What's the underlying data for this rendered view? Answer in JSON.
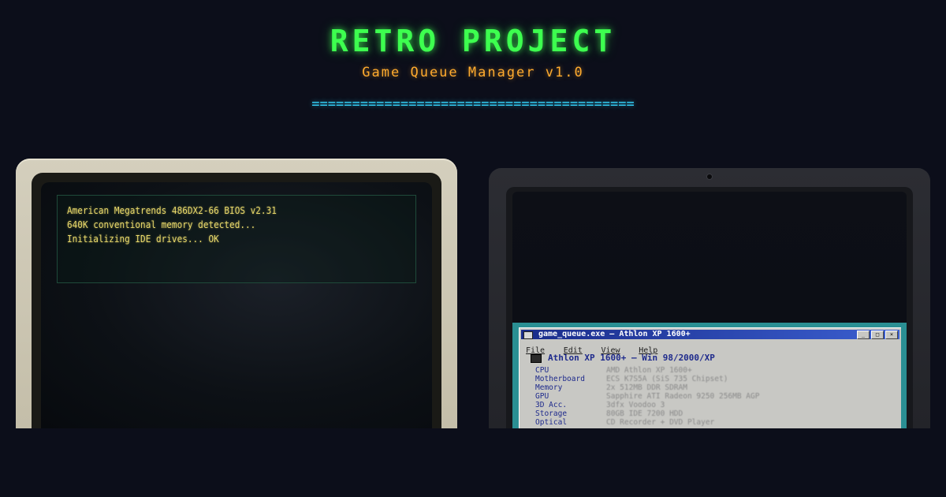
{
  "header": {
    "title": "RETRO PROJECT",
    "subtitle": "Game Queue Manager v1.0",
    "divider": "========================================"
  },
  "crt": {
    "bios_lines": [
      "American Megatrends 486DX2-66 BIOS v2.31",
      "640K conventional memory detected...",
      "Initializing IDE drives... OK"
    ]
  },
  "laptop": {
    "window": {
      "title": "game_queue.exe — Athlon XP 1600+",
      "menu": [
        "File",
        "Edit",
        "View",
        "Help"
      ],
      "heading": "Athlon XP 1600+ — Win 98/2000/XP",
      "specs": [
        {
          "label": "CPU",
          "value": "AMD Athlon XP 1600+"
        },
        {
          "label": "Motherboard",
          "value": "ECS K7S5A (SiS 735 Chipset)"
        },
        {
          "label": "Memory",
          "value": "2x 512MB DDR SDRAM"
        },
        {
          "label": "GPU",
          "value": "Sapphire ATI Radeon 9250 256MB AGP"
        },
        {
          "label": "3D Acc.",
          "value": "3dfx Voodoo 3"
        },
        {
          "label": "Storage",
          "value": "80GB IDE 7200 HDD"
        },
        {
          "label": "Optical",
          "value": "CD Recorder + DVD Player"
        }
      ]
    }
  },
  "colors": {
    "title": "#3dff4f",
    "subtitle": "#ffab2e",
    "divider": "#35d6ff",
    "bios_text": "#e8d86a",
    "win_titlebar": "#1a2c8a"
  }
}
